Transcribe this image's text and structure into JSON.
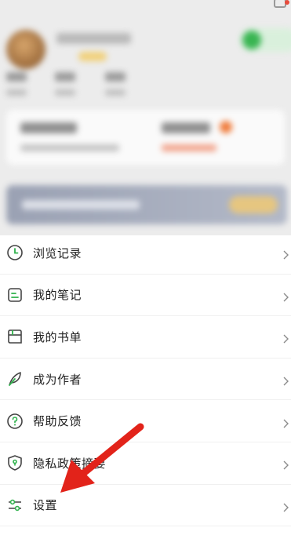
{
  "menu": {
    "items": [
      {
        "label": "浏览记录",
        "icon": "clock-icon"
      },
      {
        "label": "我的笔记",
        "icon": "note-icon"
      },
      {
        "label": "我的书单",
        "icon": "booklist-icon"
      },
      {
        "label": "成为作者",
        "icon": "feather-icon"
      },
      {
        "label": "帮助反馈",
        "icon": "help-icon"
      },
      {
        "label": "隐私政策摘要",
        "icon": "shield-icon"
      },
      {
        "label": "设置",
        "icon": "settings-sliders-icon"
      }
    ]
  },
  "colors": {
    "accent_green": "#2fb24c",
    "icon_stroke": "#444444",
    "annotation_red": "#e2231a",
    "chevron": "#8a8a8a"
  }
}
